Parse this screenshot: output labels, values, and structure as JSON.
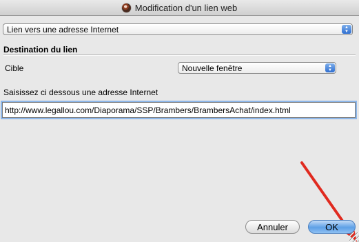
{
  "window": {
    "title": "Modification d'un lien web"
  },
  "link_type": {
    "selected": "Lien vers une adresse Internet"
  },
  "destination": {
    "section_title": "Destination du lien",
    "target_label": "Cible",
    "target_selected": "Nouvelle fenêtre"
  },
  "url": {
    "prompt": "Saisissez ci dessous une adresse Internet",
    "value": "http://www.legallou.com/Diaporama/SSP/Brambers/BrambersAchat/index.html"
  },
  "buttons": {
    "cancel": "Annuler",
    "ok": "OK"
  },
  "colors": {
    "accent": "#3e86de",
    "annotation_arrow": "#e02a1f"
  }
}
